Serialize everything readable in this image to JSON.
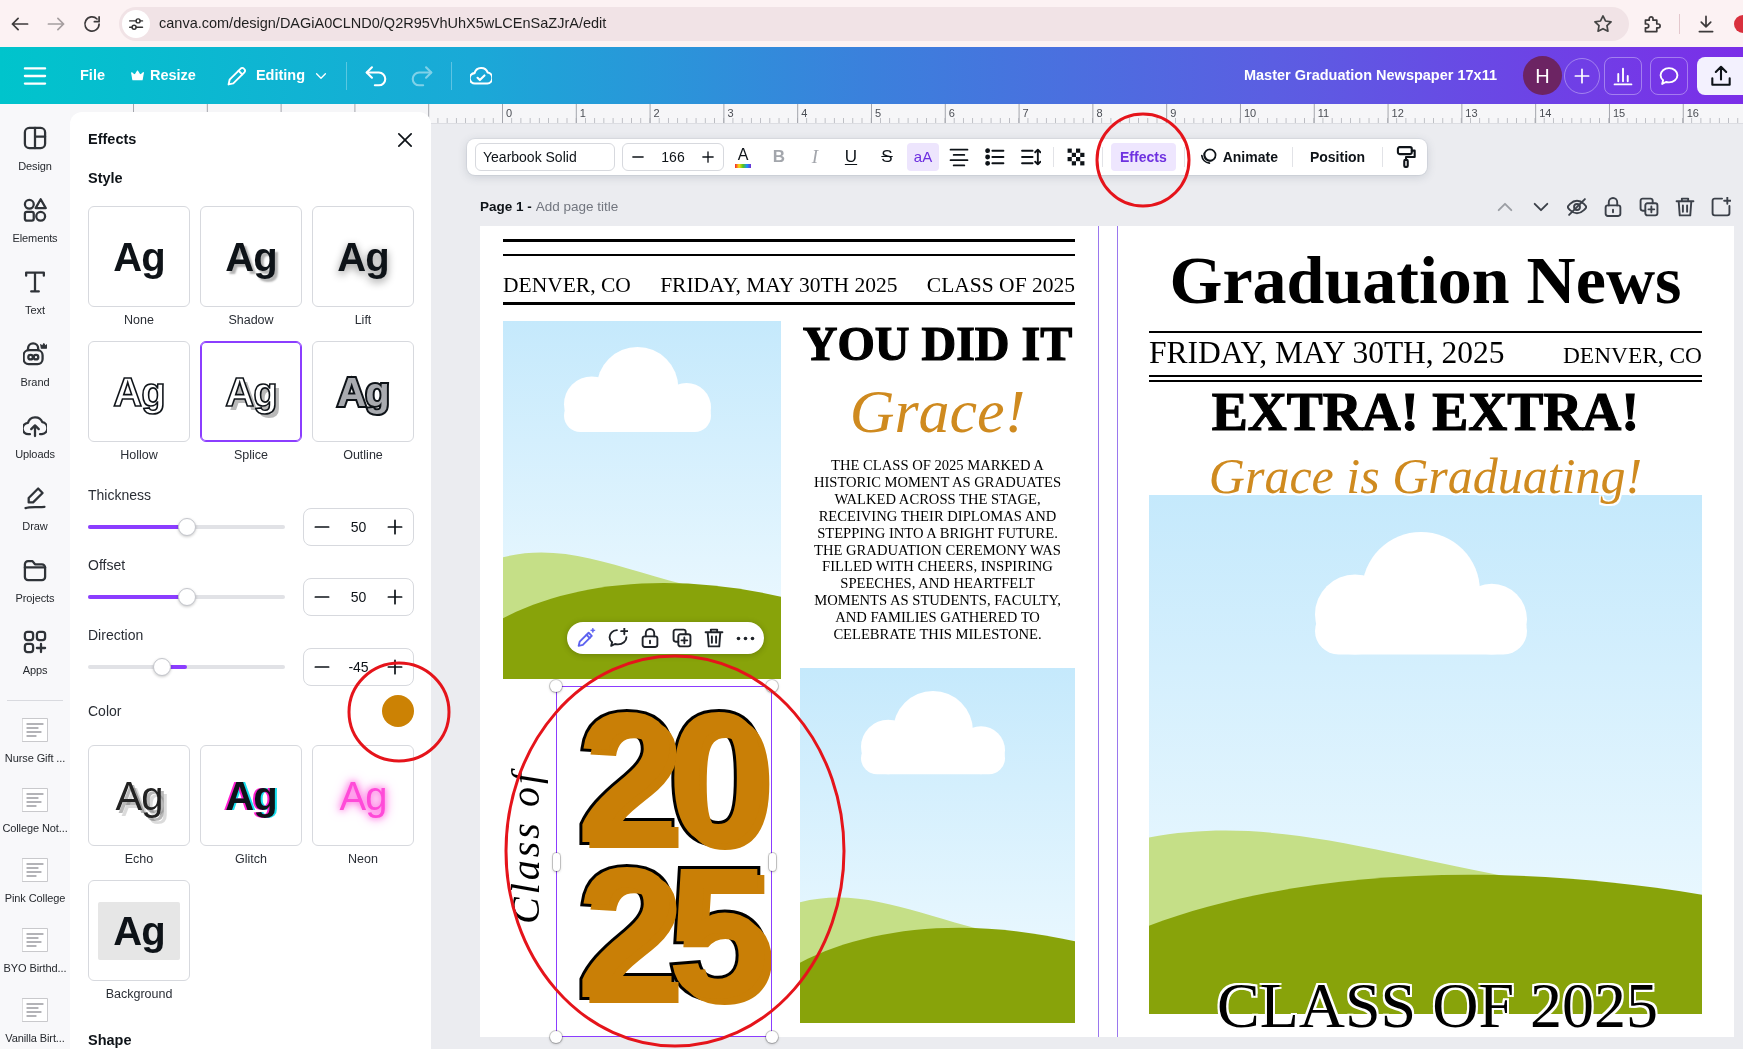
{
  "browser": {
    "nav": [
      {
        "kind": "back",
        "disabled": false
      },
      {
        "kind": "forward",
        "disabled": true
      },
      {
        "kind": "reload",
        "disabled": false
      }
    ],
    "url": "canva.com/design/DAGiA0CLND0/Q2R95VhUhX5wLCEnSaZJrA/edit"
  },
  "header": {
    "menu": [
      {
        "kind": "file",
        "label": "File"
      },
      {
        "kind": "resize",
        "label": "Resize"
      },
      {
        "kind": "mode",
        "label": "Editing"
      }
    ],
    "history": [
      {
        "kind": "undo",
        "disabled": false
      },
      {
        "kind": "redo",
        "disabled": true
      }
    ],
    "title": "Master Graduation Newspaper 17x11",
    "avatar": "H"
  },
  "sidebar": {
    "items": [
      {
        "kind": "design",
        "label": "Design"
      },
      {
        "kind": "elements",
        "label": "Elements"
      },
      {
        "kind": "text",
        "label": "Text"
      },
      {
        "kind": "brand",
        "label": "Brand"
      },
      {
        "kind": "uploads",
        "label": "Uploads"
      },
      {
        "kind": "draw",
        "label": "Draw"
      },
      {
        "kind": "projects",
        "label": "Projects"
      },
      {
        "kind": "apps",
        "label": "Apps"
      }
    ],
    "recent": [
      {
        "label": "Nurse Gift ..."
      },
      {
        "label": "College Not..."
      },
      {
        "label": "Pink College"
      },
      {
        "label": "BYO Birthd..."
      },
      {
        "label": "Vanilla Birt..."
      }
    ]
  },
  "ruler": [
    "0",
    "1",
    "2",
    "3",
    "4",
    "5",
    "6",
    "7",
    "8",
    "9",
    "10",
    "11",
    "12",
    "13",
    "14",
    "15",
    "16"
  ],
  "effects_panel": {
    "title": "Effects",
    "heading": "Style",
    "styles": [
      {
        "kind": "none",
        "sample": "Ag",
        "label": "None",
        "selected": false
      },
      {
        "kind": "shadow",
        "sample": "Ag",
        "label": "Shadow",
        "selected": false
      },
      {
        "kind": "lift",
        "sample": "Ag",
        "label": "Lift",
        "selected": false
      },
      {
        "kind": "hollow",
        "sample": "Ag",
        "label": "Hollow",
        "selected": false
      },
      {
        "kind": "splice",
        "sample": "Ag",
        "label": "Splice",
        "selected": true
      },
      {
        "kind": "outline",
        "sample": "Ag",
        "label": "Outline",
        "selected": false
      }
    ],
    "settings": [
      {
        "kind": "start",
        "label": "Thickness",
        "value": "50",
        "level": 0.5
      },
      {
        "kind": "start",
        "label": "Offset",
        "value": "50",
        "level": 0.5
      },
      {
        "kind": "center",
        "label": "Direction",
        "value": "-45",
        "level": 0.375
      }
    ],
    "color": {
      "label": "Color",
      "color": "#cc8204",
      "circled": true
    },
    "more_styles": [
      {
        "kind": "echo",
        "sample": "Ag",
        "label": "Echo",
        "selected": false
      },
      {
        "kind": "glitch",
        "sample": "Ag",
        "label": "Glitch",
        "selected": false
      },
      {
        "kind": "neon",
        "sample": "Ag",
        "label": "Neon",
        "selected": false
      },
      {
        "kind": "background",
        "sample": "Ag",
        "label": "Background",
        "selected": false
      }
    ],
    "footer_heading": "Shape"
  },
  "text_toolbar": {
    "font": "Yearbook Solid",
    "size": "166",
    "tools": [
      {
        "kind": "color",
        "label": "A",
        "selected": false,
        "disabled": false
      },
      {
        "kind": "bold",
        "label": "B",
        "selected": false,
        "disabled": true
      },
      {
        "kind": "italic",
        "label": "I",
        "selected": false,
        "disabled": true
      },
      {
        "kind": "underline",
        "label": "U",
        "selected": false,
        "disabled": false
      },
      {
        "kind": "strike",
        "label": "S",
        "selected": false,
        "disabled": false
      },
      {
        "kind": "case",
        "label": "aA",
        "selected": true,
        "disabled": false
      },
      {
        "kind": "align",
        "selected": false,
        "disabled": false
      },
      {
        "kind": "list",
        "selected": false,
        "disabled": false
      },
      {
        "kind": "spacing",
        "selected": false,
        "disabled": false
      },
      {
        "kind": "transparency",
        "selected": false,
        "disabled": false
      }
    ],
    "actions": [
      {
        "kind": "effects",
        "label": "Effects",
        "selected": true,
        "circled": true
      },
      {
        "kind": "animate",
        "label": "Animate",
        "selected": false,
        "circled": false
      },
      {
        "kind": "position",
        "label": "Position",
        "selected": false,
        "circled": false
      }
    ]
  },
  "page_bar": {
    "label": "Page 1 -",
    "placeholder": "Add page title",
    "actions": [
      {
        "kind": "up",
        "disabled": true
      },
      {
        "kind": "down",
        "disabled": false
      },
      {
        "kind": "hide",
        "disabled": false
      },
      {
        "kind": "lock",
        "disabled": false
      },
      {
        "kind": "duplicate",
        "disabled": false
      },
      {
        "kind": "delete",
        "disabled": false
      },
      {
        "kind": "add",
        "disabled": false
      }
    ]
  },
  "page": {
    "left": {
      "dateline": [
        "DENVER, CO",
        "FRIDAY, MAY 30TH 2025",
        "CLASS OF 2025"
      ],
      "headline": "YOU DID IT",
      "script": "Grace!",
      "article": [
        "THE CLASS OF 2025 MARKED A",
        "HISTORIC MOMENT AS GRADUATES",
        "WALKED ACROSS THE STAGE,",
        "RECEIVING THEIR DIPLOMAS AND",
        "STEPPING INTO A BRIGHT FUTURE.",
        "THE GRADUATION CEREMONY WAS",
        "FILLED WITH CHEERS, INSPIRING",
        "SPEECHES, AND HEARTFELT",
        "MOMENTS AS STUDENTS, FACULTY,",
        "AND FAMILIES GATHERED TO",
        "CELEBRATE THIS MILESTONE."
      ],
      "graphic": {
        "caption": "Class of",
        "numerals": [
          "20",
          "25"
        ],
        "selected": true,
        "circled": true
      }
    },
    "right": {
      "masthead": "Graduation News",
      "date": "FRIDAY, MAY 30TH, 2025",
      "location": "DENVER, CO",
      "headline": "EXTRA! EXTRA!",
      "script": "Grace is Graduating!",
      "footer": "CLASS OF 2025"
    }
  }
}
